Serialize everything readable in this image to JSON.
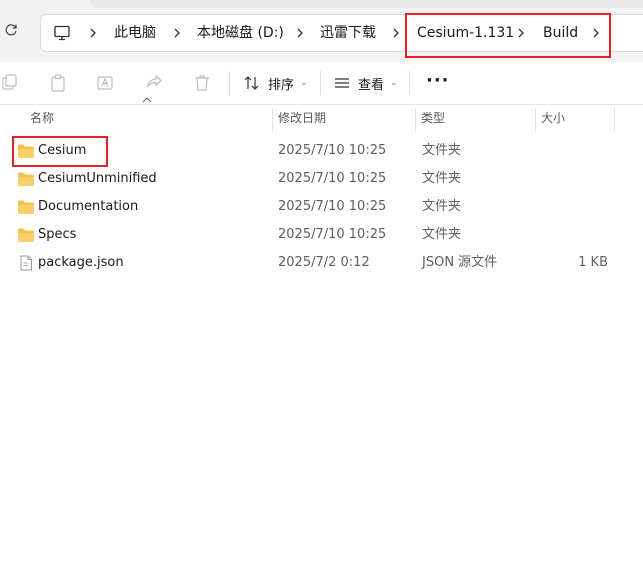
{
  "addressbar": {
    "crumbs": [
      "此电脑",
      "本地磁盘 (D:)",
      "迅雷下载",
      "Cesium-1.131",
      "Build"
    ]
  },
  "toolbar": {
    "sort_label": "排序",
    "view_label": "查看",
    "more_label": "···"
  },
  "columns": {
    "name": "名称",
    "modified": "修改日期",
    "type": "类型",
    "size": "大小"
  },
  "files": [
    {
      "name": "Cesium",
      "modified": "2025/7/10 10:25",
      "type": "文件夹",
      "size": "",
      "icon": "folder-icon"
    },
    {
      "name": "CesiumUnminified",
      "modified": "2025/7/10 10:25",
      "type": "文件夹",
      "size": "",
      "icon": "folder-icon"
    },
    {
      "name": "Documentation",
      "modified": "2025/7/10 10:25",
      "type": "文件夹",
      "size": "",
      "icon": "folder-icon"
    },
    {
      "name": "Specs",
      "modified": "2025/7/10 10:25",
      "type": "文件夹",
      "size": "",
      "icon": "folder-icon"
    },
    {
      "name": "package.json",
      "modified": "2025/7/2 0:12",
      "type": "JSON 源文件",
      "size": "1 KB",
      "icon": "file-icon"
    }
  ],
  "colors": {
    "highlight_box": "#e0222a",
    "folder": "#f2c14e"
  }
}
